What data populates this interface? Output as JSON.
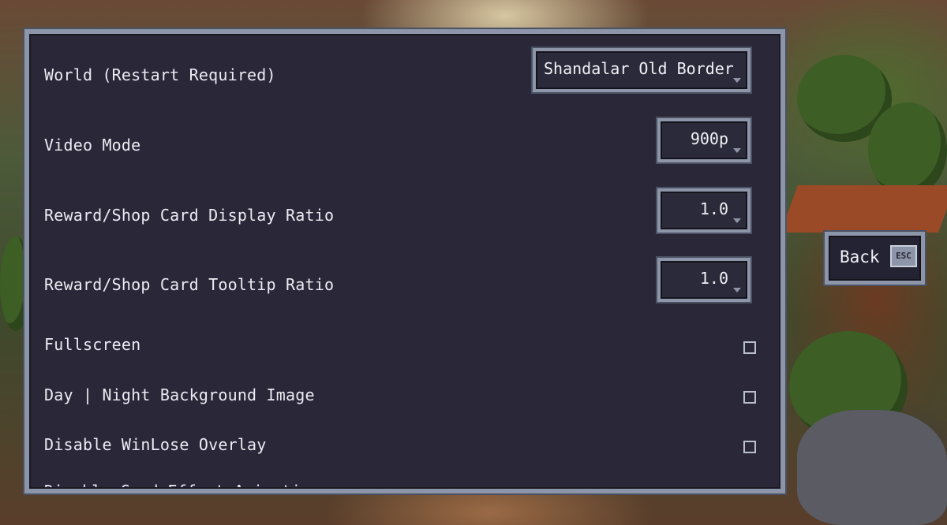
{
  "settings": {
    "world": {
      "label": "World (Restart Required)",
      "value": "Shandalar Old Border"
    },
    "video_mode": {
      "label": "Video Mode",
      "value": "900p"
    },
    "reward_display_ratio": {
      "label": "Reward/Shop Card Display Ratio",
      "value": "1.0"
    },
    "reward_tooltip_ratio": {
      "label": "Reward/Shop Card Tooltip Ratio",
      "value": "1.0"
    },
    "fullscreen": {
      "label": "Fullscreen",
      "checked": false
    },
    "day_night_background": {
      "label": "Day | Night Background Image",
      "checked": false
    },
    "disable_winlose_overlay": {
      "label": "Disable WinLose Overlay",
      "checked": false
    },
    "cut_off_row": {
      "label": "Disable Card Effect Animations"
    }
  },
  "back_button": {
    "label": "Back",
    "key_hint": "ESC"
  },
  "colors": {
    "panel_bg": "#2a2838",
    "panel_frame": "#8d95a9",
    "text": "#eceaf2"
  }
}
